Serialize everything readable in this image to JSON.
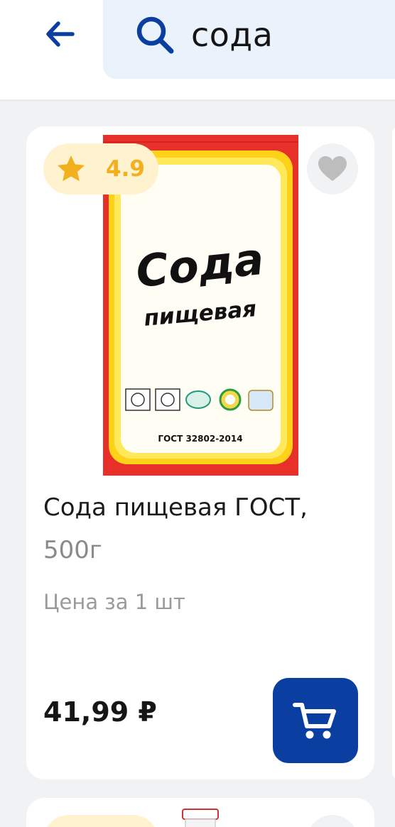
{
  "header": {
    "back_icon": "arrow-left-icon",
    "search": {
      "icon": "search-icon",
      "query": "сода"
    }
  },
  "product": {
    "image_text": {
      "brand_line_1": "Сода",
      "brand_line_2": "пищевая",
      "standard": "ГОСТ 32802-2014"
    },
    "rating": "4.9",
    "rating_icon": "star-icon",
    "favorite_icon": "heart-icon",
    "title": "Сода пищевая ГОСТ,",
    "weight": "500г",
    "price_unit": "Цена за 1 шт",
    "price": "41,99 ₽",
    "cart_icon": "cart-icon"
  },
  "colors": {
    "accent": "#0a3ea0",
    "rating": "#f2b01e",
    "rating_badge_bg": "#fff2cf",
    "search_bg": "#eaf2fb",
    "package_red": "#e8302a",
    "package_yellow": "#ffd21a"
  }
}
